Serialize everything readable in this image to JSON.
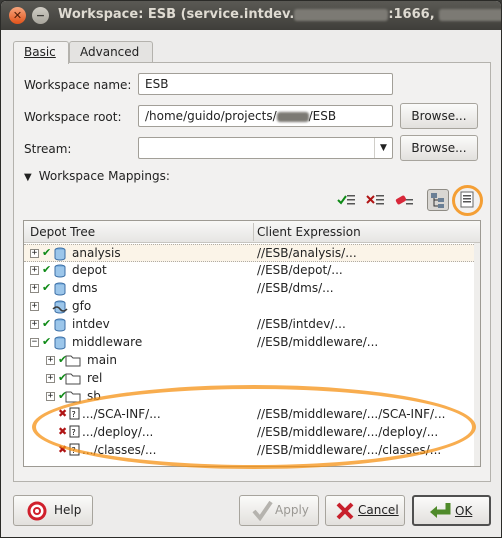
{
  "window": {
    "title_prefix": "Workspace: ESB (service.intdev.",
    "title_suffix": ":1666,"
  },
  "tabs": [
    {
      "label": "Basic",
      "active": true
    },
    {
      "label": "Advanced",
      "active": false
    }
  ],
  "form": {
    "name_label": "Workspace name:",
    "name_value": "ESB",
    "root_label": "Workspace root:",
    "root_value_prefix": "/home/guido/projects/",
    "root_value_suffix": "/ESB",
    "stream_label": "Stream:",
    "stream_value": "",
    "browse_label": "Browse...",
    "mappings_label": "Workspace Mappings:"
  },
  "toolbar": {
    "icons": [
      "include-mapping-icon",
      "exclude-mapping-icon",
      "clear-mapping-icon",
      "tree-view-icon",
      "text-view-icon"
    ]
  },
  "tree": {
    "col_depot": "Depot Tree",
    "col_client": "Client Expression",
    "rows": [
      {
        "name": "analysis",
        "expr": "//ESB/analysis/...",
        "mark": "include",
        "icon": "depot-icon"
      },
      {
        "name": "depot",
        "expr": "//ESB/depot/...",
        "mark": "include",
        "icon": "depot-icon"
      },
      {
        "name": "dms",
        "expr": "//ESB/dms/...",
        "mark": "include",
        "icon": "depot-icon"
      },
      {
        "name": "gfo",
        "expr": "",
        "mark": "none",
        "icon": "stream-depot-icon"
      },
      {
        "name": "intdev",
        "expr": "//ESB/intdev/...",
        "mark": "include",
        "icon": "depot-icon"
      },
      {
        "name": "middleware",
        "expr": "//ESB/middleware/...",
        "mark": "include",
        "icon": "depot-icon"
      },
      {
        "name": "main",
        "expr": "",
        "mark": "include",
        "icon": "folder-icon"
      },
      {
        "name": "rel",
        "expr": "",
        "mark": "include",
        "icon": "folder-icon"
      },
      {
        "name": "sb",
        "expr": "",
        "mark": "include",
        "icon": "folder-icon"
      },
      {
        "name": ".../SCA-INF/...",
        "expr": "//ESB/middleware/.../SCA-INF/...",
        "mark": "exclude",
        "icon": "wildcard-icon"
      },
      {
        "name": ".../deploy/...",
        "expr": "//ESB/middleware/.../deploy/...",
        "mark": "exclude",
        "icon": "wildcard-icon"
      },
      {
        "name": ".../classes/...",
        "expr": "//ESB/middleware/.../classes/...",
        "mark": "exclude",
        "icon": "wildcard-icon"
      }
    ]
  },
  "buttons": {
    "help": "Help",
    "apply": "Apply",
    "cancel": "Cancel",
    "ok": "OK"
  },
  "colors": {
    "accent": "#f5911e",
    "include": "#0e8a16",
    "exclude": "#b01515"
  }
}
